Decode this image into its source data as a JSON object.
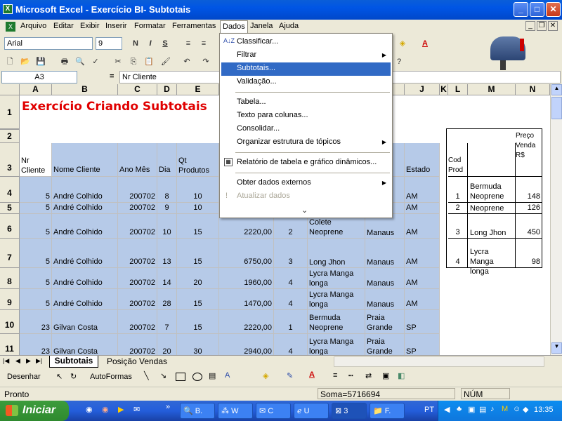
{
  "window": {
    "title": "Microsoft Excel - Exercício BI- Subtotais",
    "minimize": "_",
    "maximize": "□",
    "close": "✕"
  },
  "menubar": {
    "items": [
      "Arquivo",
      "Editar",
      "Exibir",
      "Inserir",
      "Formatar",
      "Ferramentas",
      "Dados",
      "Janela",
      "Ajuda"
    ],
    "doc_minimize": "_",
    "doc_restore": "❐",
    "doc_close": "✕"
  },
  "format_toolbar": {
    "font": "Arial",
    "size": "9",
    "bold": "N",
    "italic": "I",
    "underline": "S"
  },
  "formula_bar": {
    "name_box": "A3",
    "fx": "=",
    "value": "Nr Cliente"
  },
  "dados_menu": {
    "items": [
      "Classificar...",
      "Filtrar",
      "Subtotais...",
      "Validação...",
      "Tabela...",
      "Texto para colunas...",
      "Consolidar...",
      "Organizar estrutura de tópicos",
      "Relatório de tabela e gráfico dinâmicos...",
      "Obter dados externos",
      "Atualizar dados"
    ],
    "expand": "⌄"
  },
  "columns": [
    "A",
    "B",
    "C",
    "D",
    "E",
    "",
    "",
    "",
    "",
    "J",
    "K",
    "L",
    "M",
    "N"
  ],
  "rows": [
    "1",
    "2",
    "3",
    "4",
    "5",
    "6",
    "7",
    "8",
    "9",
    "10",
    "11"
  ],
  "sheet": {
    "title": "Exercício Criando Subtotais",
    "headers": {
      "a": "Nr Cliente",
      "b": "Nome Cliente",
      "c": "Ano Mês",
      "d": "Dia",
      "e": "Qt Produtos",
      "i": "e",
      "j": "Estado"
    },
    "data": [
      {
        "a": "5",
        "b": "André Colhido",
        "c": "200702",
        "d": "8",
        "e": "10",
        "g": "",
        "h": "",
        "i": "aus",
        "j": "AM"
      },
      {
        "a": "5",
        "b": "André Colhido",
        "c": "200702",
        "d": "9",
        "e": "10",
        "g": "",
        "h": "",
        "i": "aus",
        "j": "AM"
      },
      {
        "a": "5",
        "b": "André Colhido",
        "c": "200702",
        "d": "10",
        "e": "15",
        "f": "2220,00",
        "g": "2",
        "h": "Colete Neoprene",
        "i": "Manaus",
        "j": "AM"
      },
      {
        "a": "5",
        "b": "André Colhido",
        "c": "200702",
        "d": "13",
        "e": "15",
        "f": "6750,00",
        "g": "3",
        "h": "Long Jhon",
        "i": "Manaus",
        "j": "AM"
      },
      {
        "a": "5",
        "b": "André Colhido",
        "c": "200702",
        "d": "14",
        "e": "20",
        "f": "1960,00",
        "g": "4",
        "h": "Lycra Manga longa",
        "i": "Manaus",
        "j": "AM"
      },
      {
        "a": "5",
        "b": "André Colhido",
        "c": "200702",
        "d": "28",
        "e": "15",
        "f": "1470,00",
        "g": "4",
        "h": "Lycra Manga longa",
        "i": "Manaus",
        "j": "AM"
      },
      {
        "a": "23",
        "b": "Gilvan Costa",
        "c": "200702",
        "d": "7",
        "e": "15",
        "f": "2220,00",
        "g": "1",
        "h": "Bermuda Neoprene",
        "i": "Praia Grande",
        "j": "SP"
      },
      {
        "a": "23",
        "b": "Gilvan Costa",
        "c": "200702",
        "d": "20",
        "e": "30",
        "f": "2940,00",
        "g": "4",
        "h": "Lycra Manga longa",
        "i": "Praia Grande",
        "j": "SP"
      }
    ],
    "lookup": {
      "headers": {
        "cod": "Cod Prod",
        "preco": "Preço Venda R$"
      },
      "rows": [
        {
          "cod": "1",
          "name": "Bermuda Neoprene",
          "price": "148"
        },
        {
          "cod": "2",
          "name": "Neoprene",
          "price": "126"
        },
        {
          "cod": "3",
          "name": "Long Jhon",
          "price": "450"
        },
        {
          "cod": "4",
          "name": "Lycra Manga longa",
          "price": "98"
        }
      ]
    }
  },
  "sheet_tabs": [
    "Subtotais",
    "Posição Vendas"
  ],
  "drawing_toolbar": {
    "draw": "Desenhar",
    "autoshapes": "AutoFormas"
  },
  "status": {
    "ready": "Pronto",
    "sum": "Soma=5716694",
    "num": "NÚM"
  },
  "taskbar": {
    "start": "Iniciar",
    "buttons": [
      "B.",
      "W",
      "C",
      "U",
      "3",
      "F."
    ],
    "lang": "PT",
    "clock": "13:35"
  }
}
